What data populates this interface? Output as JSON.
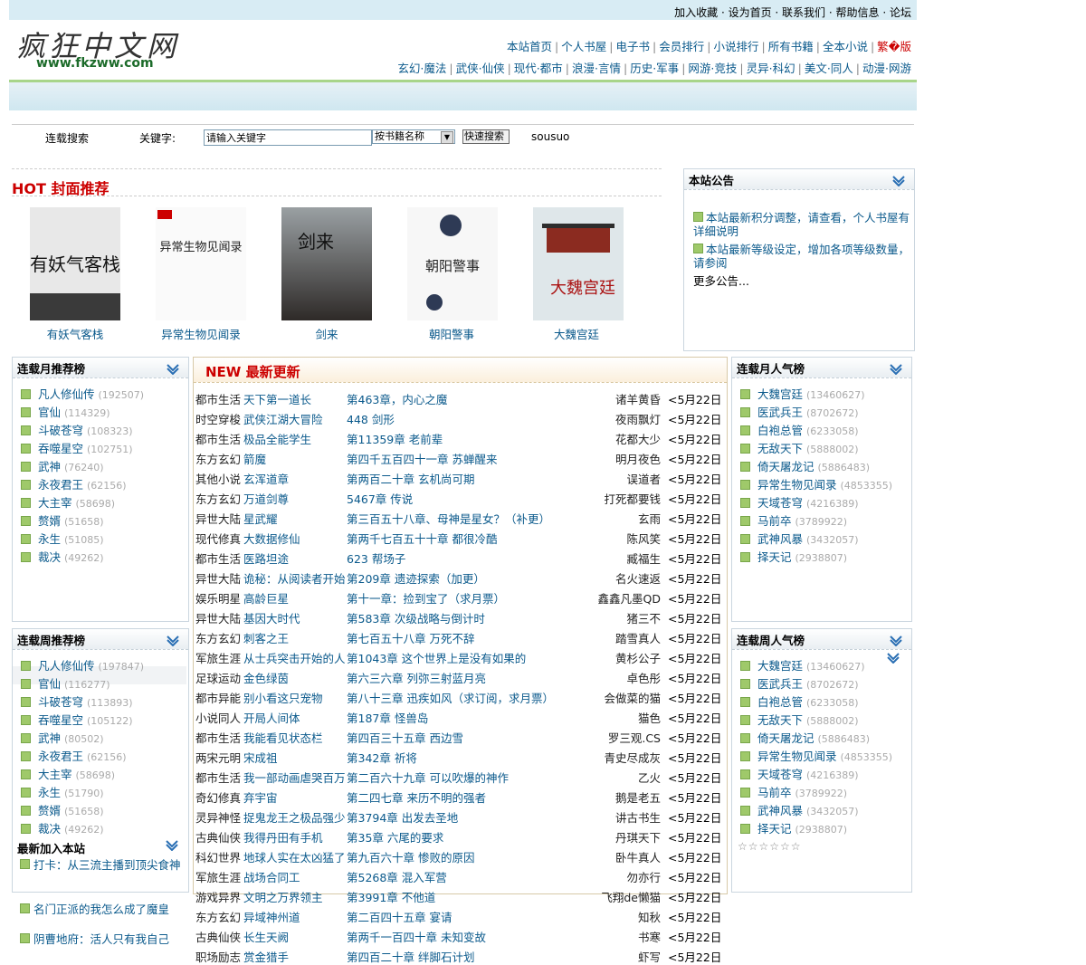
{
  "top_links": [
    "加入收藏",
    "设为首页",
    "联系我们",
    "帮助信息",
    "论坛"
  ],
  "logo": {
    "cn": "疯狂中文网",
    "en": "www.fkzww.com"
  },
  "nav_main": [
    "本站首页",
    "个人书屋",
    "电子书",
    "会员排行",
    "小说排行",
    "所有书籍",
    "全本小说",
    "繁�版"
  ],
  "nav_categories": [
    "玄幻·魔法",
    "武侠·仙侠",
    "现代·都市",
    "浪漫·言情",
    "历史·军事",
    "网游·竞技",
    "灵异·科幻",
    "美文·同人",
    "动漫·网游"
  ],
  "search": {
    "label": "连载搜索",
    "keyword_label": "关键字:",
    "placeholder": "请输入关键字",
    "select_value": "按书籍名称",
    "button": "快速搜索",
    "extra": "sousuo"
  },
  "hot": {
    "title_hot": "HOT",
    "title_rest": "封面推荐",
    "covers": [
      {
        "title": "有妖气客栈",
        "cover_text": "有妖气客栈",
        "color": "#2a2a2a"
      },
      {
        "title": "异常生物见闻录",
        "cover_text": "异常生物见闻录",
        "color": "#f3f3f3"
      },
      {
        "title": "剑来",
        "cover_text": "剑来",
        "color": "#555a5e"
      },
      {
        "title": "朝阳警事",
        "cover_text": "朝阳警事",
        "color": "#f5f5f5"
      },
      {
        "title": "大魏宫廷",
        "cover_text": "大魏宫廷",
        "color": "#c8d6dc"
      }
    ]
  },
  "notice": {
    "title": "本站公告",
    "items": [
      "本站最新积分调整，请查看，个人书屋有详细说明",
      "本站最新等级设定，增加各项等级数量，请参阅"
    ],
    "more": "更多公告..."
  },
  "month_rec": {
    "title": "连载月推荐榜",
    "items": [
      {
        "name": "凡人修仙传",
        "count": "(192507)"
      },
      {
        "name": "官仙",
        "count": "(114329)"
      },
      {
        "name": "斗破苍穹",
        "count": "(108323)"
      },
      {
        "name": "吞噬星空",
        "count": "(102751)"
      },
      {
        "name": "武神",
        "count": "(76240)"
      },
      {
        "name": "永夜君王",
        "count": "(62156)"
      },
      {
        "name": "大主宰",
        "count": "(58698)"
      },
      {
        "name": "赘婿",
        "count": "(51658)"
      },
      {
        "name": "永生",
        "count": "(51085)"
      },
      {
        "name": "裁决",
        "count": "(49262)"
      }
    ]
  },
  "week_rec": {
    "title": "连载周推荐榜",
    "items": [
      {
        "name": "凡人修仙传",
        "count": "(197847)"
      },
      {
        "name": "官仙",
        "count": "(116277)"
      },
      {
        "name": "斗破苍穹",
        "count": "(113893)"
      },
      {
        "name": "吞噬星空",
        "count": "(105122)"
      },
      {
        "name": "武神",
        "count": "(80502)"
      },
      {
        "name": "永夜君王",
        "count": "(62156)"
      },
      {
        "name": "大主宰",
        "count": "(58698)"
      },
      {
        "name": "永生",
        "count": "(51790)"
      },
      {
        "name": "赘婿",
        "count": "(51658)"
      },
      {
        "name": "裁决",
        "count": "(49262)"
      }
    ]
  },
  "month_pop": {
    "title": "连载月人气榜",
    "items": [
      {
        "name": "大魏宫廷",
        "count": "(13460627)"
      },
      {
        "name": "医武兵王",
        "count": "(8702672)"
      },
      {
        "name": "白袍总管",
        "count": "(6233058)"
      },
      {
        "name": "无敌天下",
        "count": "(5888002)"
      },
      {
        "name": "倚天屠龙记",
        "count": "(5886483)"
      },
      {
        "name": "异常生物见闻录",
        "count": "(4853355)"
      },
      {
        "name": "天域苍穹",
        "count": "(4216389)"
      },
      {
        "name": "马前卒",
        "count": "(3789922)"
      },
      {
        "name": "武神风暴",
        "count": "(3432057)"
      },
      {
        "name": "择天记",
        "count": "(2938807)"
      }
    ]
  },
  "week_pop": {
    "title": "连载周人气榜",
    "items": [
      {
        "name": "大魏宫廷",
        "count": "(13460627)"
      },
      {
        "name": "医武兵王",
        "count": "(8702672)"
      },
      {
        "name": "白袍总管",
        "count": "(6233058)"
      },
      {
        "name": "无敌天下",
        "count": "(5888002)"
      },
      {
        "name": "倚天屠龙记",
        "count": "(5886483)"
      },
      {
        "name": "异常生物见闻录",
        "count": "(4853355)"
      },
      {
        "name": "天域苍穹",
        "count": "(4216389)"
      },
      {
        "name": "马前卒",
        "count": "(3789922)"
      },
      {
        "name": "武神风暴",
        "count": "(3432057)"
      },
      {
        "name": "择天记",
        "count": "(2938807)"
      }
    ],
    "stars": "☆☆☆☆☆☆"
  },
  "new_join": {
    "title": "最新加入本站",
    "items": [
      "打卡：从三流主播到顶尖食神",
      "名门正派的我怎么成了魔皇",
      "阴曹地府：活人只有我自己"
    ]
  },
  "updates": {
    "title_new": "NEW",
    "title_rest": "最新更新",
    "rows": [
      {
        "cat": "都市生活",
        "book": "天下第一道长",
        "chapter": "第463章，内心之魔",
        "author": "诸羊黄昏",
        "date": "<5月22日"
      },
      {
        "cat": "时空穿梭",
        "book": "武侠江湖大冒险",
        "chapter": "448 剑形",
        "author": "夜雨飘灯",
        "date": "<5月22日"
      },
      {
        "cat": "都市生活",
        "book": "极品全能学生",
        "chapter": "第11359章 老前辈",
        "author": "花都大少",
        "date": "<5月22日"
      },
      {
        "cat": "东方玄幻",
        "book": "箭魔",
        "chapter": "第四千五百四十一章 苏蝉醒来",
        "author": "明月夜色",
        "date": "<5月22日"
      },
      {
        "cat": "其他小说",
        "book": "玄浑道章",
        "chapter": "第两百二十章 玄机尚可期",
        "author": "误道者",
        "date": "<5月22日"
      },
      {
        "cat": "东方玄幻",
        "book": "万道剑尊",
        "chapter": "5467章 传说",
        "author": "打死都要钱",
        "date": "<5月22日"
      },
      {
        "cat": "异世大陆",
        "book": "星武耀",
        "chapter": "第三百五十八章、母神是星女？（补更）",
        "author": "玄雨",
        "date": "<5月22日"
      },
      {
        "cat": "现代修真",
        "book": "大数据修仙",
        "chapter": "第两千七百五十十章 都很冷酷",
        "author": "陈风笑",
        "date": "<5月22日"
      },
      {
        "cat": "都市生活",
        "book": "医路坦途",
        "chapter": "623 帮场子",
        "author": "臧福生",
        "date": "<5月22日"
      },
      {
        "cat": "异世大陆",
        "book": "诡秘：从阅读者开始",
        "chapter": "第209章 遗迹探索（加更）",
        "author": "名火速返",
        "date": "<5月22日"
      },
      {
        "cat": "娱乐明星",
        "book": "高龄巨星",
        "chapter": "第十一章：捡到宝了（求月票）",
        "author": "鑫鑫凡墨QD",
        "date": "<5月22日"
      },
      {
        "cat": "异世大陆",
        "book": "基因大时代",
        "chapter": "第583章 次级战略与倒计时",
        "author": "猪三不",
        "date": "<5月22日"
      },
      {
        "cat": "东方玄幻",
        "book": "刺客之王",
        "chapter": "第七百五十八章 万死不辞",
        "author": "踏雪真人",
        "date": "<5月22日"
      },
      {
        "cat": "军旅生涯",
        "book": "从士兵突击开始的人生",
        "chapter": "第1043章 这个世界上是没有如果的",
        "author": "黄杉公子",
        "date": "<5月22日"
      },
      {
        "cat": "足球运动",
        "book": "金色绿茵",
        "chapter": "第六三六章 列弥三射蓝月亮",
        "author": "卓色彤",
        "date": "<5月22日"
      },
      {
        "cat": "都市异能",
        "book": "别小看这只宠物",
        "chapter": "第八十三章 迅疾如风（求订阅，求月票）",
        "author": "会做菜的猫",
        "date": "<5月22日"
      },
      {
        "cat": "小说同人",
        "book": "开局人间体",
        "chapter": "第187章 怪兽岛",
        "author": "猫色",
        "date": "<5月22日"
      },
      {
        "cat": "都市生活",
        "book": "我能看见状态栏",
        "chapter": "第四百三十五章 西边雪",
        "author": "罗三观.CS",
        "date": "<5月22日"
      },
      {
        "cat": "两宋元明",
        "book": "宋成祖",
        "chapter": "第342章 祈将",
        "author": "青史尽成灰",
        "date": "<5月22日"
      },
      {
        "cat": "都市生活",
        "book": "我一部动画虐哭百万人",
        "chapter": "第二百六十九章 可以吹爆的神作",
        "author": "乙火",
        "date": "<5月22日"
      },
      {
        "cat": "奇幻修真",
        "book": "弃宇宙",
        "chapter": "第二四七章 来历不明的强者",
        "author": "鹅是老五",
        "date": "<5月22日"
      },
      {
        "cat": "灵异神怪",
        "book": "捉鬼龙王之极品强少",
        "chapter": "第3794章 出发去圣地",
        "author": "讲古书生",
        "date": "<5月22日"
      },
      {
        "cat": "古典仙侠",
        "book": "我得丹田有手机",
        "chapter": "第35章 六尾的要求",
        "author": "丹琪天下",
        "date": "<5月22日"
      },
      {
        "cat": "科幻世界",
        "book": "地球人实在太凶猛了",
        "chapter": "第九百六十章 惨败的原因",
        "author": "卧牛真人",
        "date": "<5月22日"
      },
      {
        "cat": "军旅生涯",
        "book": "战场合同工",
        "chapter": "第5268章 混入军营",
        "author": "勿亦行",
        "date": "<5月22日"
      },
      {
        "cat": "游戏异界",
        "book": "文明之万界领主",
        "chapter": "第3991章 不他道",
        "author": "飞翔de懒猫",
        "date": "<5月22日"
      },
      {
        "cat": "东方玄幻",
        "book": "异域神州道",
        "chapter": "第二百四十五章 宴请",
        "author": "知秋",
        "date": "<5月22日"
      },
      {
        "cat": "古典仙侠",
        "book": "长生天阙",
        "chapter": "第两千一百四十章 未知变故",
        "author": "书寒",
        "date": "<5月22日"
      },
      {
        "cat": "职场励志",
        "book": "赏金猎手",
        "chapter": "第四百二十章 绊脚石计划",
        "author": "虾写",
        "date": "<5月22日"
      }
    ]
  }
}
